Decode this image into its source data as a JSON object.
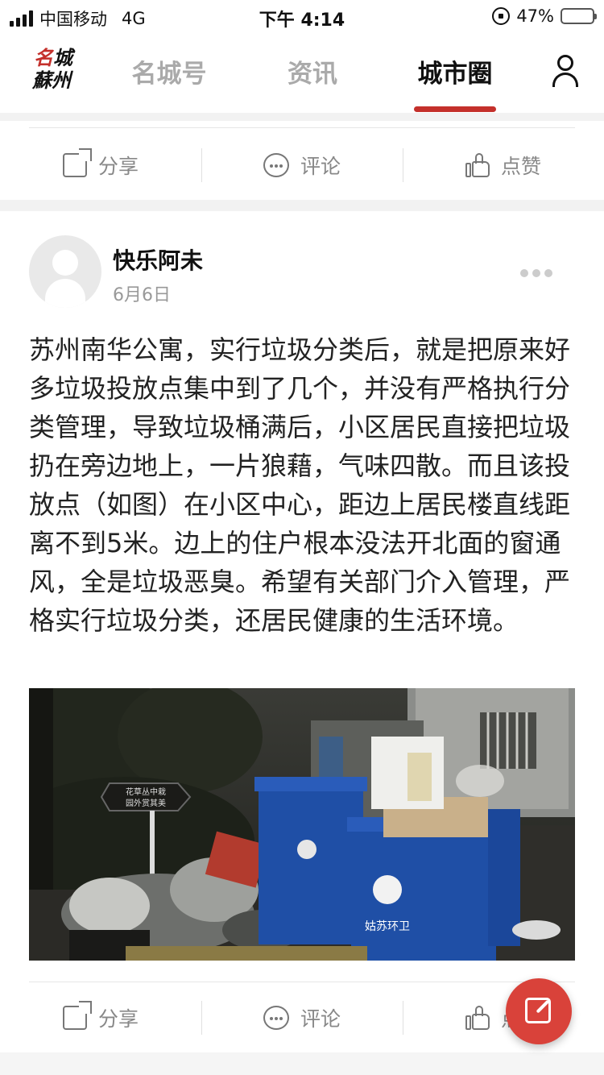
{
  "status_bar": {
    "carrier": "中国移动",
    "network": "4G",
    "time": "下午 4:14",
    "battery": "47%",
    "battery_level": 0.47
  },
  "nav": {
    "logo_top": "名城",
    "logo_bottom": "蘇州",
    "tabs": [
      {
        "label": "名城号",
        "active": false
      },
      {
        "label": "资讯",
        "active": false
      },
      {
        "label": "城市圈",
        "active": true
      }
    ],
    "user_icon": "user-icon"
  },
  "top_card": {
    "actions": {
      "share": "分享",
      "comment": "评论",
      "like": "点赞"
    }
  },
  "post": {
    "author": "快乐阿未",
    "date": "6月6日",
    "text": "苏州南华公寓，实行垃圾分类后，就是把原来好多垃圾投放点集中到了几个，并没有严格执行分类管理，导致垃圾桶满后，小区居民直接把垃圾扔在旁边地上，一片狼藉，气味四散。而且该投放点（如图）在小区中心，距边上居民楼直线距离不到5米。边上的住户根本没法开北面的窗通风，全是垃圾恶臭。希望有关部门介入管理，严格实行垃圾分类，还居民健康的生活环境。",
    "photo": {
      "sign_line1": "花草丛中栽",
      "sign_line2": "园外赏其美",
      "bin_label": "姑苏环卫"
    },
    "actions": {
      "share": "分享",
      "comment": "评论",
      "like": "点赞"
    }
  },
  "colors": {
    "accent": "#c4302b",
    "fab": "#d9423a",
    "bin_blue": "#1f4fa6"
  }
}
